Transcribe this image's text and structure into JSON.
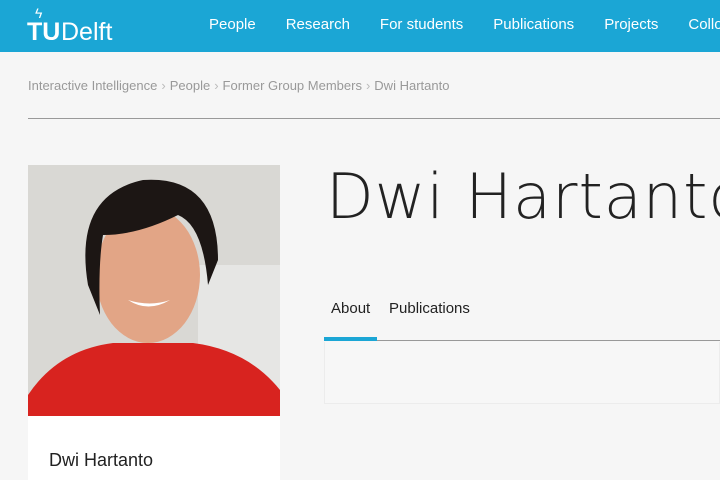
{
  "header": {
    "logo": "TU Delft",
    "logo_tu": "TU",
    "logo_delft": "Delft",
    "brand_color": "#1ba6d5",
    "nav": [
      "People",
      "Research",
      "For students",
      "Publications",
      "Projects",
      "Collo"
    ]
  },
  "breadcrumb": [
    "Interactive Intelligence",
    "People",
    "Former Group Members",
    "Dwi Hartanto"
  ],
  "breadcrumb_separator": "›",
  "profile": {
    "name": "Dwi Hartanto",
    "card_name": "Dwi Hartanto",
    "photo": "profile-photo"
  },
  "tabs": [
    {
      "label": "About",
      "active": true
    },
    {
      "label": "Publications",
      "active": false
    }
  ]
}
